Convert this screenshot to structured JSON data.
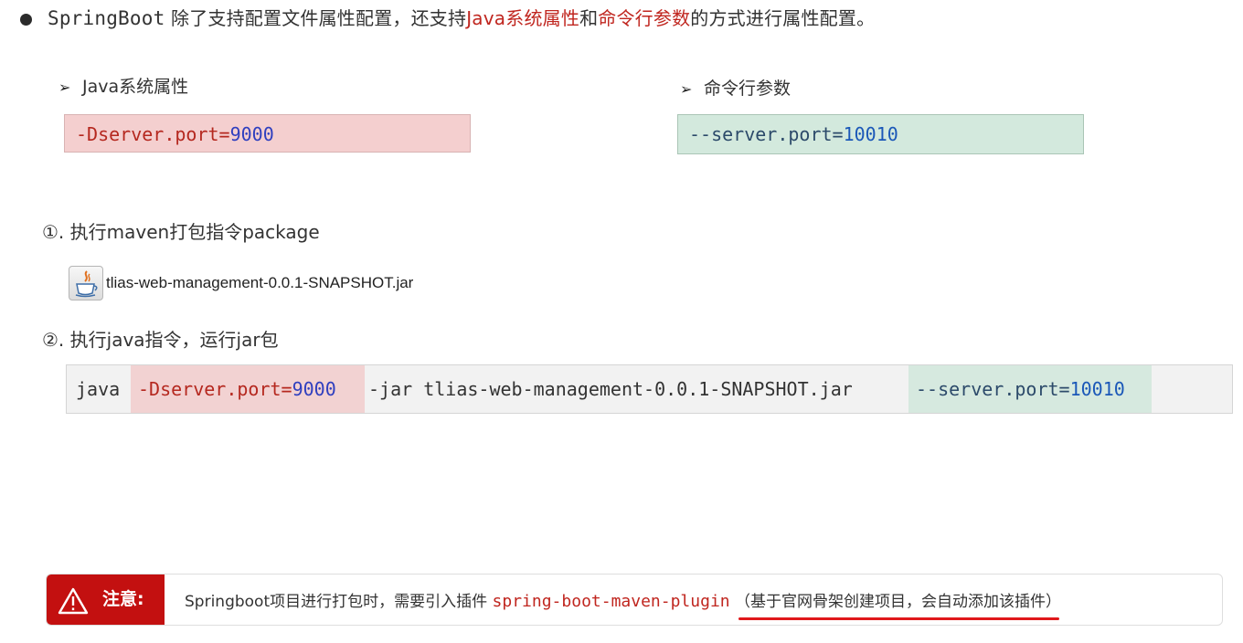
{
  "intro": {
    "prefix": "SpringBoot",
    "text1": " 除了支持配置文件属性配置，还支持",
    "java_highlight": "Java系统属性",
    "and": "和",
    "cmd_highlight": "命令行参数",
    "text2": "的方式进行属性配置。"
  },
  "java_props": {
    "heading": "Java系统属性",
    "code_flag": "-Dserver.port=",
    "code_value": "9000"
  },
  "cmd_args": {
    "heading": "命令行参数",
    "code_flag": "--server.port=",
    "code_value": "10010"
  },
  "step1": {
    "label": "①. 执行maven打包指令package",
    "jar_file": "tlias-web-management-0.0.1-SNAPSHOT.jar"
  },
  "step2": {
    "label": "②. 执行java指令，运行jar包",
    "cmd_java": "java",
    "cmd_d_flag": "-Dserver.port=",
    "cmd_d_value": "9000",
    "cmd_jar": "-jar tlias-web-management-0.0.1-SNAPSHOT.jar",
    "cmd_s_flag": "--server.port=",
    "cmd_s_value": "10010"
  },
  "note": {
    "label": "注意:",
    "text": "Springboot项目进行打包时，需要引入插件 ",
    "plugin": "spring-boot-maven-plugin",
    "paren": "（基于官网骨架创建项目，会自动添加该插件）"
  },
  "colors": {
    "highlight_red": "#c0261f",
    "java_box_bg": "#f4cfcf",
    "cmd_box_bg": "#d3e9dd",
    "note_tag_bg": "#c31010",
    "underline": "#e0181b"
  },
  "icons": [
    "bullet-icon",
    "arrow-icon",
    "jar-file-icon",
    "warning-icon"
  ]
}
